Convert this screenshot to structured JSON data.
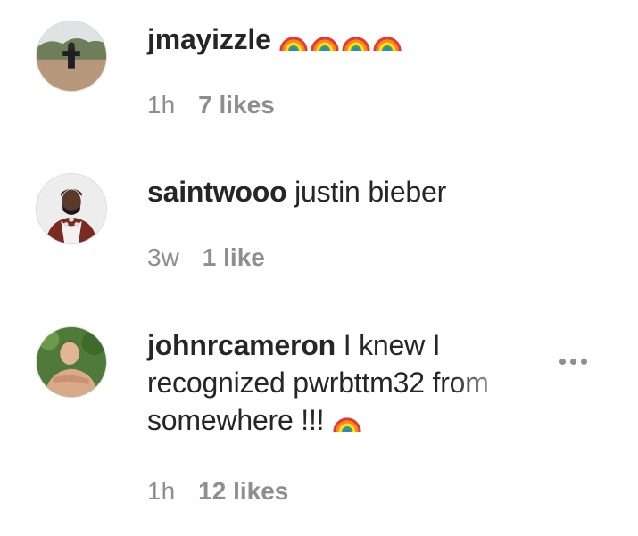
{
  "comments": [
    {
      "username": "jmayizzle",
      "text": "",
      "emojis": [
        "rainbow-icon",
        "rainbow-icon",
        "rainbow-icon",
        "rainbow-icon"
      ],
      "time": "1h",
      "likes": "7 likes"
    },
    {
      "username": "saintwooo",
      "text": "justin bieber",
      "time": "3w",
      "likes": "1 like"
    },
    {
      "username": "johnrcameron",
      "text_line1": "I knew I",
      "text_line2": "recognized pwrbttm32 from",
      "text_line3": "somewhere !!!",
      "emojis": [
        "rainbow-icon"
      ],
      "time": "1h",
      "likes": "12 likes"
    }
  ],
  "colors": {
    "text": "#262626",
    "meta": "#8e8e8e"
  }
}
